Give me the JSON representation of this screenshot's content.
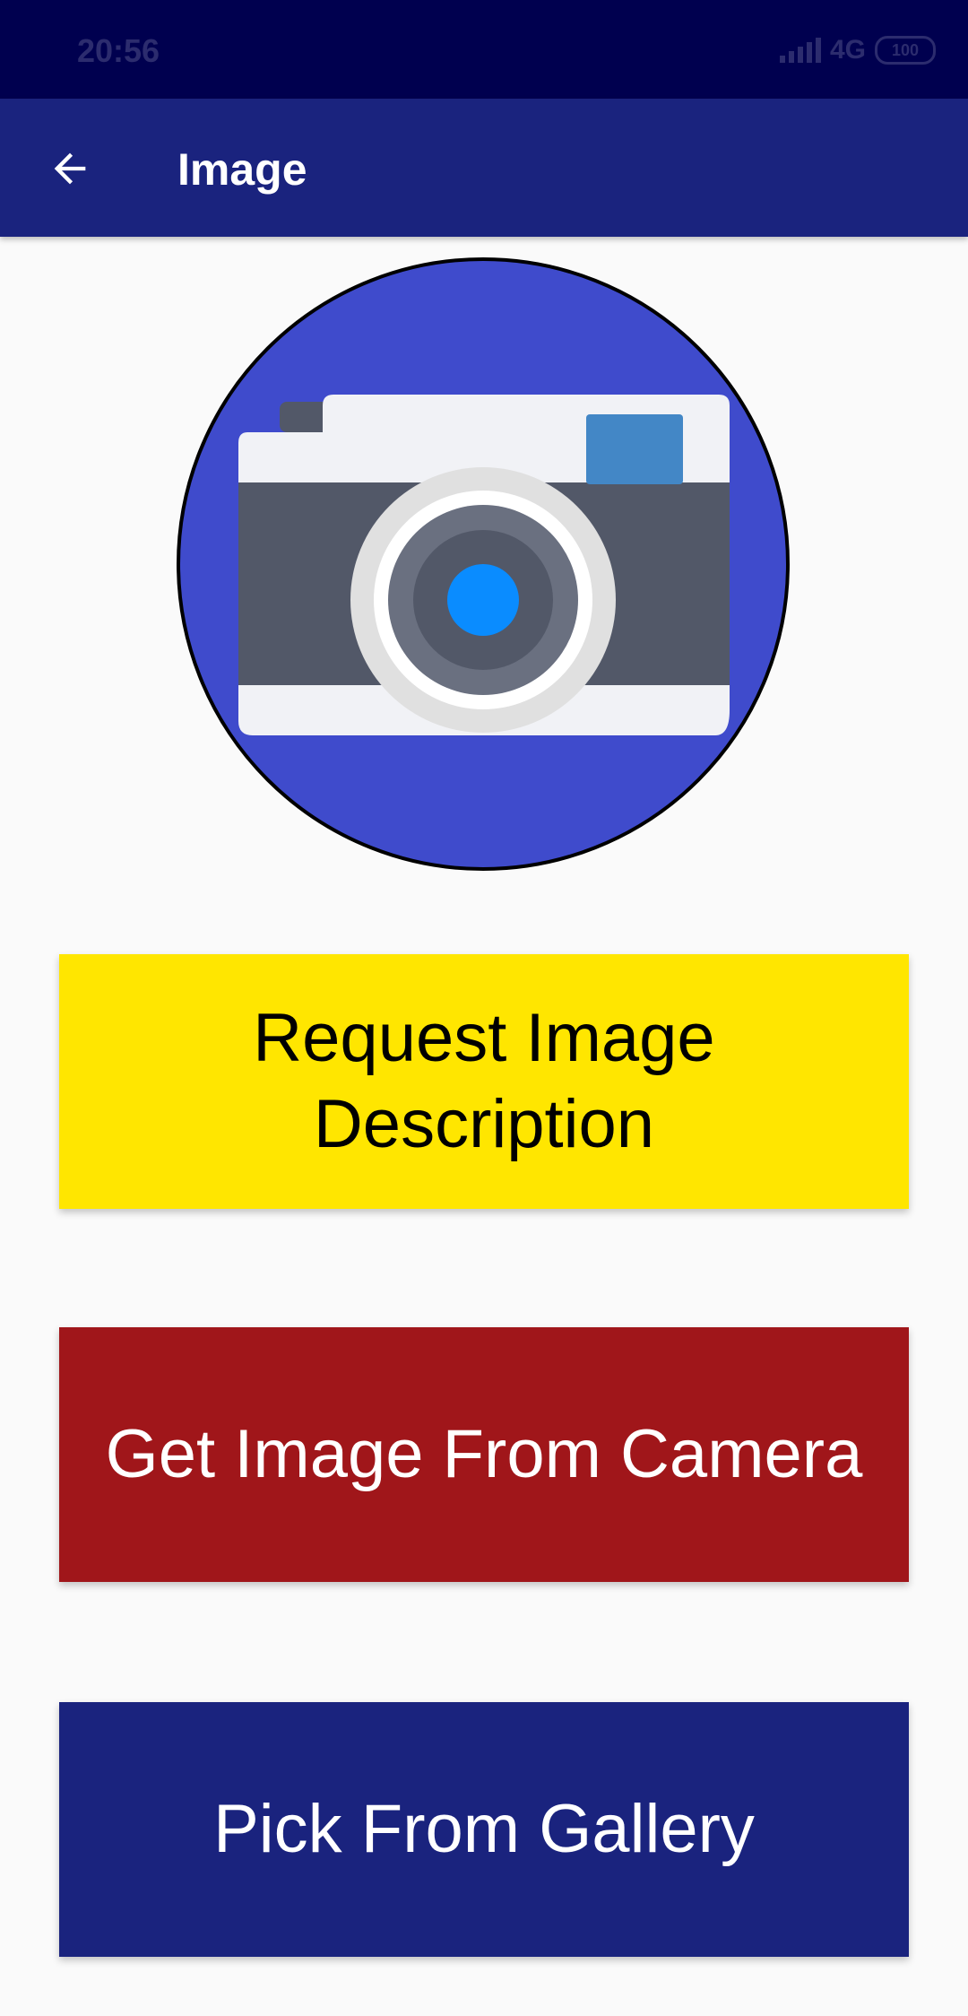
{
  "status_bar": {
    "time": "20:56",
    "network": "4G",
    "battery": "100"
  },
  "app_bar": {
    "back_icon": "arrow-left-icon",
    "title": "Image"
  },
  "header_image": {
    "icon": "camera-icon"
  },
  "buttons": {
    "request_description": "Request Image Description",
    "camera": "Get Image From Camera",
    "gallery": "Pick From Gallery"
  },
  "colors": {
    "status_bar": "#00004f",
    "app_bar": "#1a237e",
    "describe_button": "#ffe600",
    "camera_button": "#a0161a",
    "gallery_button": "#1a237e",
    "circle": "#3f4bcc"
  }
}
